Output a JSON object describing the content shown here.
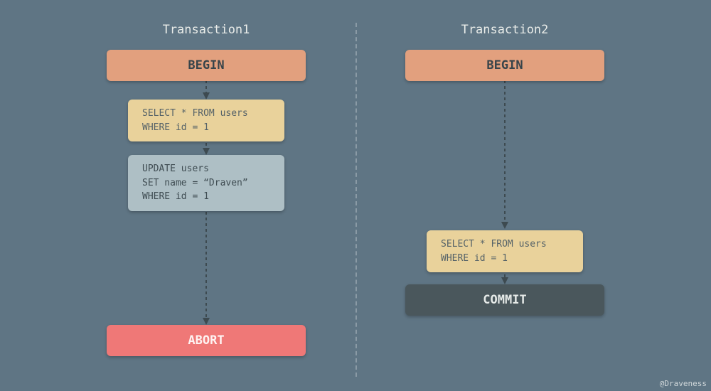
{
  "transactions": {
    "t1": {
      "title": "Transaction1",
      "begin": "BEGIN",
      "select": "SELECT * FROM users\nWHERE id = 1",
      "update": "UPDATE users\nSET name = “Draven”\nWHERE id = 1",
      "end": "ABORT"
    },
    "t2": {
      "title": "Transaction2",
      "begin": "BEGIN",
      "select": "SELECT * FROM users\nWHERE id = 1",
      "end": "COMMIT"
    }
  },
  "credit": "@Draveness",
  "colors": {
    "background": "#5f7584",
    "begin": "#e2a07e",
    "select": "#e9d29b",
    "update": "#aebfc5",
    "abort": "#ef7877",
    "commit": "#4a575c"
  }
}
